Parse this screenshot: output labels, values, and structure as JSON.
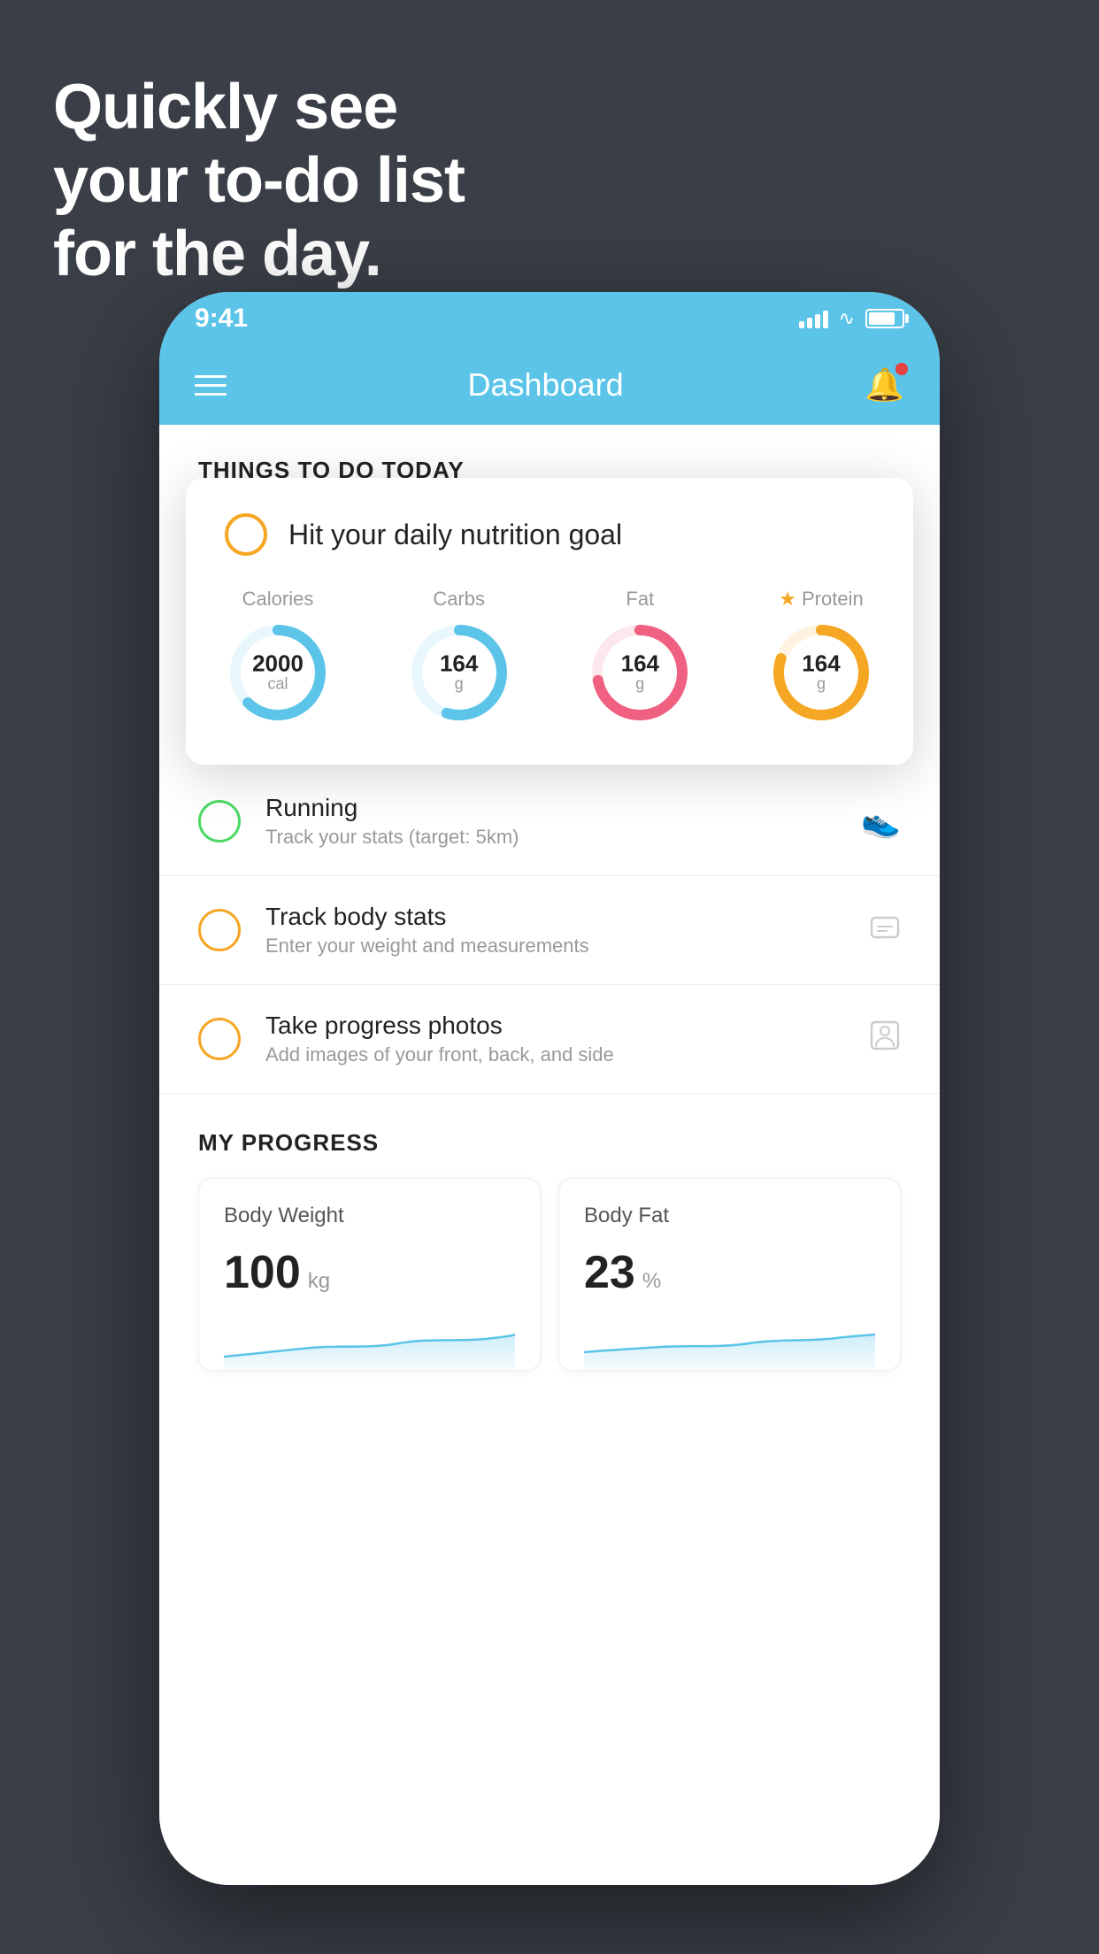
{
  "background": {
    "headline_line1": "Quickly see",
    "headline_line2": "your to-do list",
    "headline_line3": "for the day."
  },
  "status_bar": {
    "time": "9:41",
    "signal_bars": [
      8,
      12,
      16,
      20,
      22
    ],
    "show_wifi": true,
    "show_battery": true
  },
  "nav_bar": {
    "title": "Dashboard",
    "has_notification": true
  },
  "things_to_do": {
    "section_title": "THINGS TO DO TODAY"
  },
  "nutrition_card": {
    "check_type": "unchecked",
    "title": "Hit your daily nutrition goal",
    "nutrients": [
      {
        "label": "Calories",
        "value": "2000",
        "unit": "cal",
        "color": "#5bc4e8",
        "bg": "#e8f7fc",
        "progress": 0.65,
        "starred": false
      },
      {
        "label": "Carbs",
        "value": "164",
        "unit": "g",
        "color": "#5bc4e8",
        "bg": "#e8f7fc",
        "progress": 0.55,
        "starred": false
      },
      {
        "label": "Fat",
        "value": "164",
        "unit": "g",
        "color": "#f06080",
        "bg": "#fce8ec",
        "progress": 0.72,
        "starred": false
      },
      {
        "label": "Protein",
        "value": "164",
        "unit": "g",
        "color": "#f5a623",
        "bg": "#fef3e0",
        "progress": 0.8,
        "starred": true
      }
    ]
  },
  "todo_items": [
    {
      "circle_color": "green",
      "title": "Running",
      "subtitle": "Track your stats (target: 5km)",
      "icon": "shoe"
    },
    {
      "circle_color": "yellow",
      "title": "Track body stats",
      "subtitle": "Enter your weight and measurements",
      "icon": "scale"
    },
    {
      "circle_color": "yellow",
      "title": "Take progress photos",
      "subtitle": "Add images of your front, back, and side",
      "icon": "person"
    }
  ],
  "progress": {
    "section_title": "MY PROGRESS",
    "cards": [
      {
        "title": "Body Weight",
        "value": "100",
        "unit": "kg"
      },
      {
        "title": "Body Fat",
        "value": "23",
        "unit": "%"
      }
    ]
  }
}
